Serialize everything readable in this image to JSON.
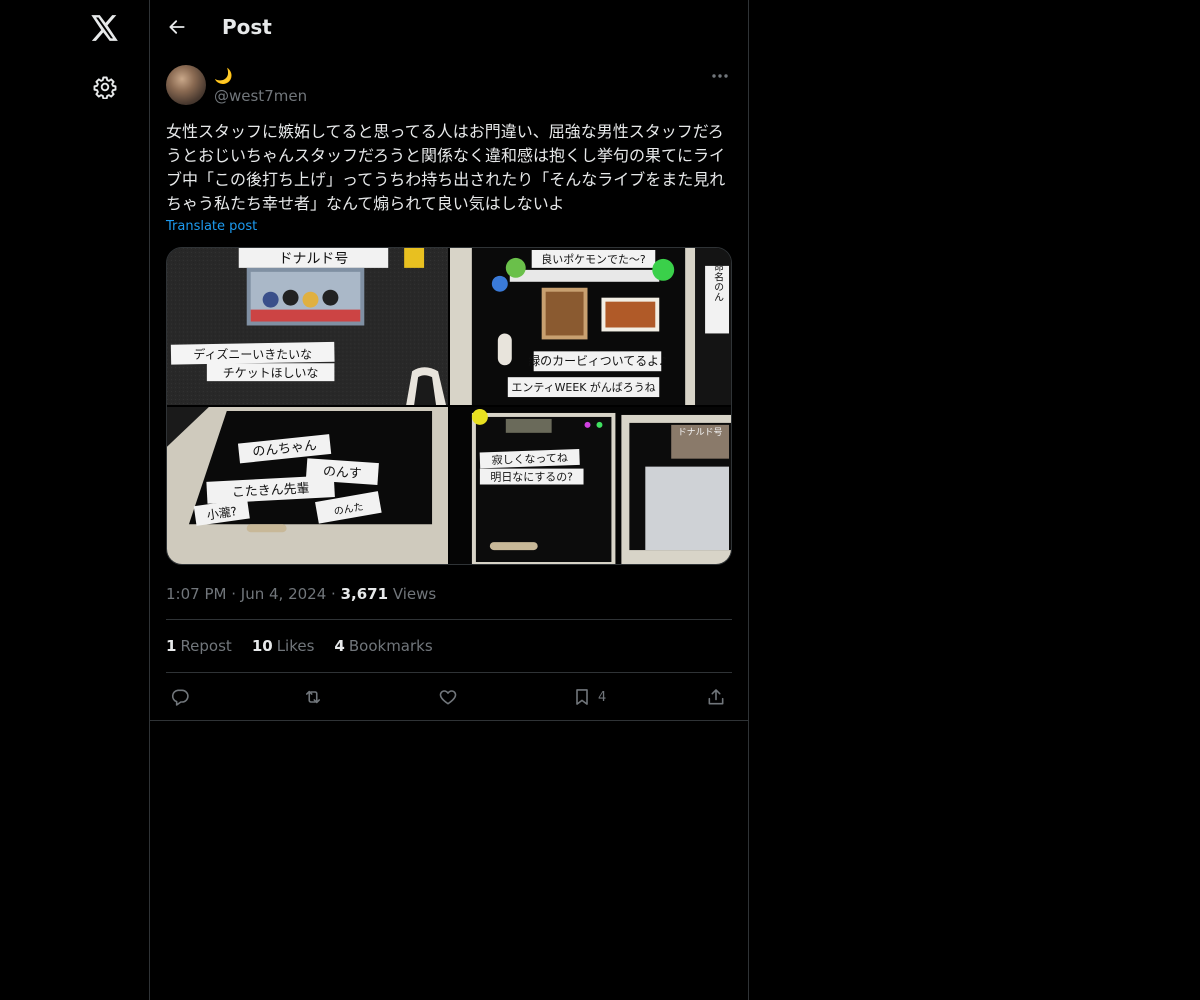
{
  "nav": {
    "logo_icon": "x-logo-icon",
    "settings_icon": "gear-icon"
  },
  "header": {
    "title": "Post",
    "back_icon": "arrow-left-icon"
  },
  "post": {
    "author": {
      "display_name": "🌙",
      "handle": "@west7men"
    },
    "text": "女性スタッフに嫉妬してると思ってる人はお門違い、屈強な男性スタッフだろうとおじいちゃんスタッフだろうと関係なく違和感は抱くし挙句の果てにライブ中「この後打ち上げ」ってうちわ持ち出されたり「そんなライブをまた見れちゃう私たち幸せ者」なんて煽られて良い気はしないよ",
    "translate_label": "Translate post",
    "media": [
      {
        "texts": [
          "ドナルド号",
          "ディズニーいきたいな",
          "チケットほしいな"
        ]
      },
      {
        "texts": [
          "良いポケモンでた〜?",
          "緑のカービィついてるよ♪",
          "エンティWEEK がんばろうね",
          "命名のん"
        ]
      },
      {
        "texts": [
          "のんちゃん",
          "のんす",
          "こたきん先輩",
          "小瀧?",
          "のんた"
        ]
      },
      {
        "texts": [
          "寂しくなってね",
          "明日なにするの?",
          "ドナルド号"
        ]
      }
    ],
    "time": "1:07 PM",
    "date": "Jun 4, 2024",
    "views_count": "3,671",
    "views_label": "Views",
    "reposts_count": "1",
    "reposts_label": "Repost",
    "likes_count": "10",
    "likes_label": "Likes",
    "bookmarks_count": "4",
    "bookmarks_label": "Bookmarks",
    "actions": {
      "bookmark_count": "4"
    }
  },
  "colors": {
    "background": "#000000",
    "border": "#2f3336",
    "text_primary": "#e7e9ea",
    "text_secondary": "#71767b",
    "accent": "#1d9bf0"
  }
}
